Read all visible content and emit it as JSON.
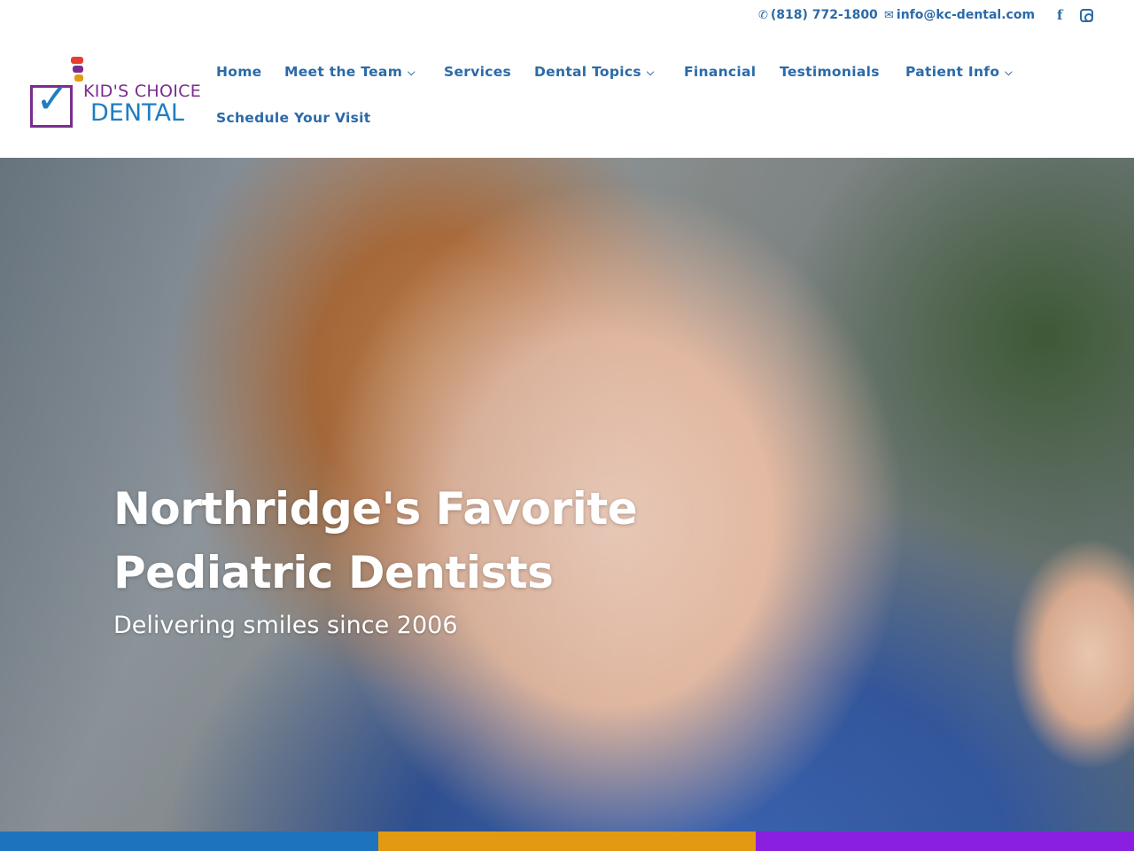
{
  "topbar": {
    "phone": "(818) 772-1800",
    "email": "info@kc-dental.com",
    "social": [
      "facebook-icon",
      "instagram-icon"
    ]
  },
  "logo": {
    "line1": "KID'S CHOICE",
    "line2": "DENTAL"
  },
  "nav": {
    "items": [
      {
        "label": "Home",
        "dropdown": false
      },
      {
        "label": "Meet the Team",
        "dropdown": true
      },
      {
        "label": "Services",
        "dropdown": false
      },
      {
        "label": "Dental Topics",
        "dropdown": true
      },
      {
        "label": "Financial",
        "dropdown": false
      },
      {
        "label": "Testimonials",
        "dropdown": false
      },
      {
        "label": "Patient Info",
        "dropdown": true
      },
      {
        "label": "Schedule Your Visit",
        "dropdown": false
      }
    ]
  },
  "hero": {
    "title_line1": "Northridge's Favorite",
    "title_line2": "Pediatric Dentists",
    "subtitle": "Delivering smiles since 2006"
  },
  "colors": {
    "nav_text": "#2b6aa8",
    "logo_purple": "#7b2d8e",
    "logo_blue": "#1f7ec2",
    "strip": [
      "#1e73be",
      "#e39a12",
      "#8a1fe0"
    ]
  }
}
